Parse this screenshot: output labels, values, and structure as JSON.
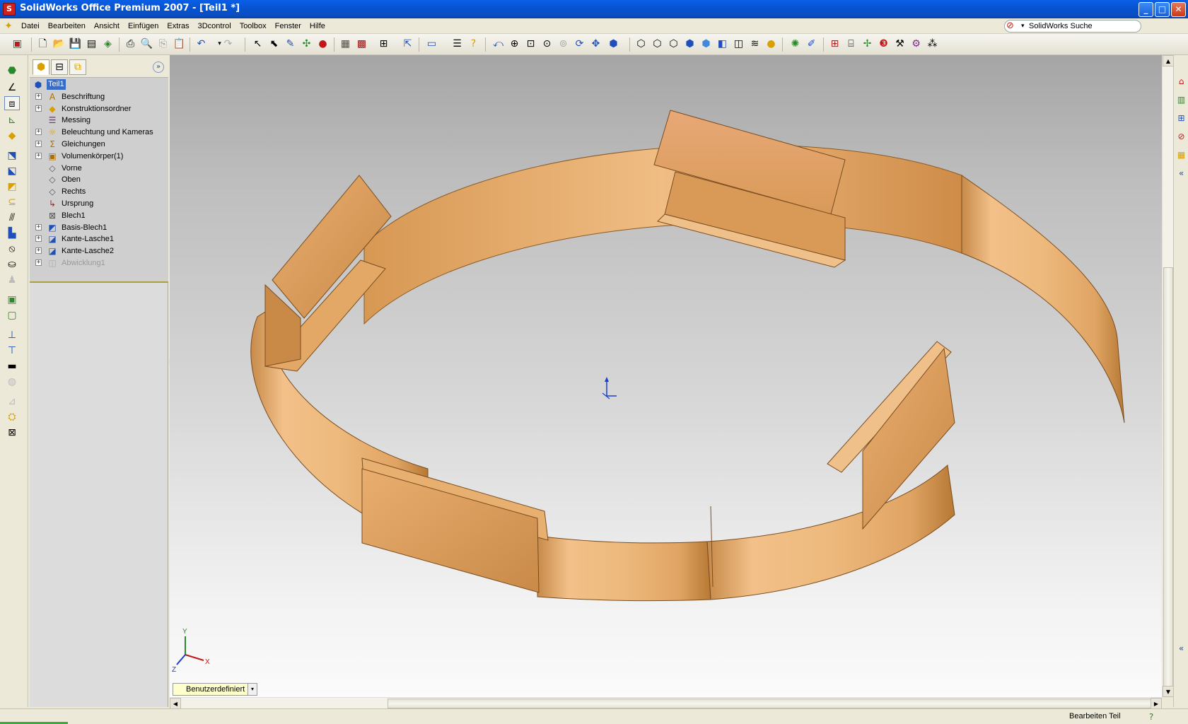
{
  "window": {
    "title": "SolidWorks Office Premium 2007 - [Teil1 *]",
    "controls": {
      "minimize": "_",
      "maximize": "□",
      "close": "✕"
    }
  },
  "menu": {
    "items": [
      "Datei",
      "Bearbeiten",
      "Ansicht",
      "Einfügen",
      "Extras",
      "3Dcontrol",
      "Toolbox",
      "Fenster",
      "Hilfe"
    ],
    "search_label": "SolidWorks Suche",
    "doc_controls": {
      "minimize": "–",
      "restore": "❐",
      "close": "✕"
    }
  },
  "toolbar": {
    "icons": [
      "rebuild-icon",
      "new-document-icon",
      "open-icon",
      "save-icon",
      "print-icon",
      "print-preview-icon",
      "copy-icon",
      "paste-icon",
      "undo-icon",
      "redo-icon",
      "select-icon",
      "zoom-to-fit-icon",
      "zoom-in-icon",
      "rotate-icon",
      "pan-icon",
      "shaded-view-icon",
      "section-view-icon"
    ]
  },
  "feature_manager": {
    "tree": [
      {
        "label": "Teil1",
        "icon": "part-icon",
        "root": true
      },
      {
        "label": "Beschriftung",
        "icon": "annotation-icon",
        "expand": true
      },
      {
        "label": "Konstruktionsordner",
        "icon": "design-folder-icon",
        "expand": true
      },
      {
        "label": "Messing",
        "icon": "material-icon",
        "expand": false
      },
      {
        "label": "Beleuchtung und Kameras",
        "icon": "lights-icon",
        "expand": true
      },
      {
        "label": "Gleichungen",
        "icon": "equations-icon",
        "expand": true
      },
      {
        "label": "Volumenkörper(1)",
        "icon": "solid-bodies-icon",
        "expand": true
      },
      {
        "label": "Vorne",
        "icon": "plane-icon",
        "expand": false
      },
      {
        "label": "Oben",
        "icon": "plane-icon",
        "expand": false
      },
      {
        "label": "Rechts",
        "icon": "plane-icon",
        "expand": false
      },
      {
        "label": "Ursprung",
        "icon": "origin-icon",
        "expand": false
      },
      {
        "label": "Blech1",
        "icon": "sheet-metal-icon",
        "expand": false
      },
      {
        "label": "Basis-Blech1",
        "icon": "base-flange-icon",
        "expand": true
      },
      {
        "label": "Kante-Lasche1",
        "icon": "edge-flange-icon",
        "expand": true
      },
      {
        "label": "Kante-Lasche2",
        "icon": "edge-flange-icon",
        "expand": true
      },
      {
        "label": "Abwicklung1",
        "icon": "flatten-icon",
        "expand": true,
        "greyed": true
      }
    ]
  },
  "viewport": {
    "view_orientation": "Benutzerdefiniert",
    "triad": {
      "x": "X",
      "y": "Y",
      "z": "Z"
    },
    "colors": {
      "metal_light": "#f2c089",
      "metal_mid": "#d99a58",
      "metal_dark": "#a96a2d",
      "origin": "#1a3fd0"
    }
  },
  "status": {
    "mode": "Bearbeiten Teil"
  }
}
